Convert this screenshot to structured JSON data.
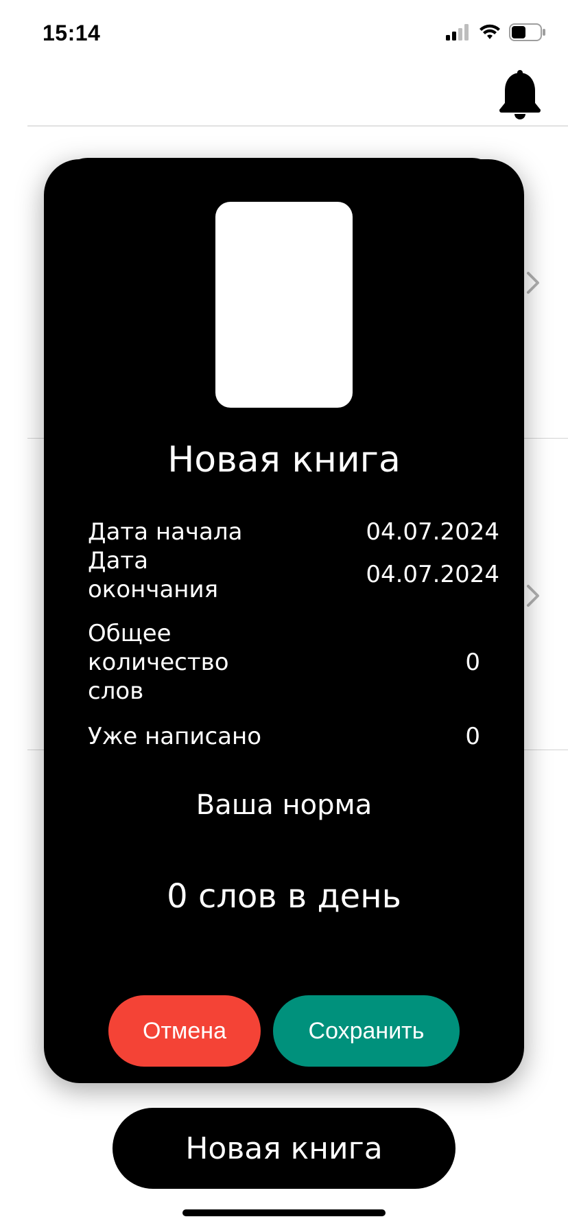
{
  "status_bar": {
    "time": "15:14",
    "icons": [
      "signal-icon",
      "wifi-icon",
      "battery-icon"
    ]
  },
  "header": {
    "icon": "bell-icon"
  },
  "modal": {
    "title": "Новая книга",
    "rows": [
      {
        "label": "Дата начала",
        "value": "04.07.2024"
      },
      {
        "label": "Дата окончания",
        "value": "04.07.2024"
      },
      {
        "label": "Общее количество слов",
        "value": "0"
      },
      {
        "label": "Уже написано",
        "value": "0"
      }
    ],
    "norm_label": "Ваша норма",
    "norm_value": "0 слов в день",
    "cancel_label": "Отмена",
    "save_label": "Сохранить"
  },
  "bottom": {
    "new_book_label": "Новая книга"
  },
  "colors": {
    "modal_bg": "#000000",
    "cancel": "#f44336",
    "save": "#00917c"
  }
}
